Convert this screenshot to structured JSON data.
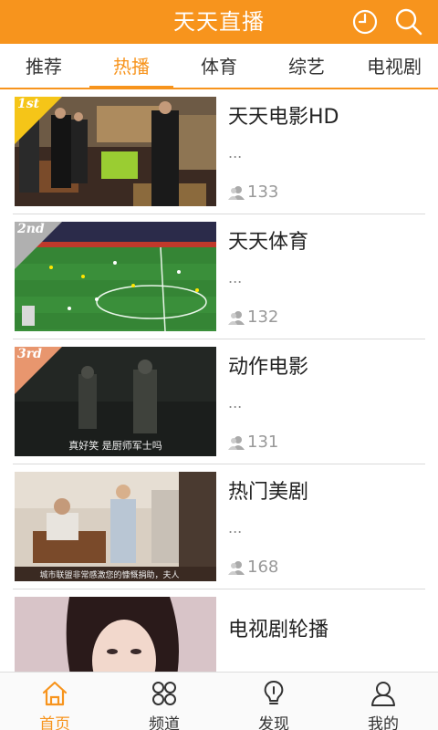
{
  "header": {
    "title": "天天直播",
    "history_icon": "clock-icon",
    "search_icon": "search-icon"
  },
  "colors": {
    "accent": "#f7941d",
    "rank_gold": "#f5c518",
    "rank_silver": "#b0b0b0",
    "rank_bronze": "#e8966e"
  },
  "tabs": [
    {
      "label": "推荐"
    },
    {
      "label": "热播"
    },
    {
      "label": "体育"
    },
    {
      "label": "综艺"
    },
    {
      "label": "电视剧"
    }
  ],
  "active_tab": "热播",
  "items": [
    {
      "rank": "1st",
      "name": "天天电影HD",
      "desc": "...",
      "viewers": "133"
    },
    {
      "rank": "2nd",
      "name": "天天体育",
      "desc": "...",
      "viewers": "132"
    },
    {
      "rank": "3rd",
      "name": "动作电影",
      "desc": "...",
      "viewers": "131",
      "subtitle": "真好笑 是厨师军士吗"
    },
    {
      "rank": "",
      "name": "热门美剧",
      "desc": "...",
      "viewers": "168",
      "subtitle": "城市联盟非常感激您的慷慨捐助，夫人"
    },
    {
      "rank": "",
      "name": "电视剧轮播",
      "desc": "",
      "viewers": ""
    }
  ],
  "bottom_nav": [
    {
      "label": "首页",
      "icon": "home-icon"
    },
    {
      "label": "频道",
      "icon": "channels-icon"
    },
    {
      "label": "发现",
      "icon": "discover-icon"
    },
    {
      "label": "我的",
      "icon": "profile-icon"
    }
  ],
  "active_nav": "首页"
}
